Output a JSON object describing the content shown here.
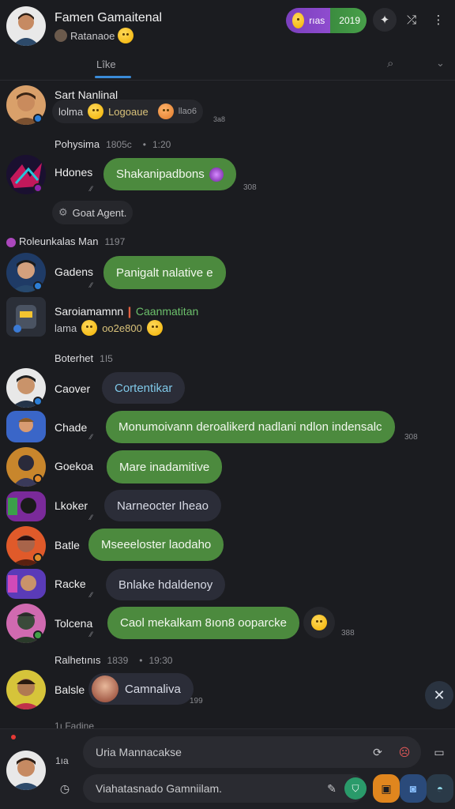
{
  "header": {
    "title": "Famen Gamaitenal",
    "subtitle": "Ratanaoe",
    "pill_left": "rıas",
    "pill_right": "2019"
  },
  "tab": {
    "label": "Lîke"
  },
  "messages": [
    {
      "name": "Sart Nanlinal",
      "text1": "lolma",
      "text2": "Logoaue",
      "meta": "llao6",
      "tick": "3a8"
    },
    {
      "name": "Pohysima",
      "time": "1805c",
      "time2": "1:20"
    },
    {
      "name": "Hdones",
      "text": "Shakanipadbons",
      "tick": "308"
    },
    {
      "name": "Goat Agent.",
      "system": true
    },
    {
      "name": "Roleunkalas Man",
      "time": "1197"
    },
    {
      "name": "Gadens",
      "text": "Panigalt nalative e"
    },
    {
      "name": "Saroiamamnn",
      "extra": "Caanmatitan",
      "sub1": "lama",
      "sub2": "oo2e800"
    },
    {
      "name": "Boterhet",
      "time": "1I5"
    },
    {
      "name": "Caover",
      "text": "Cortentikar"
    },
    {
      "name": "Chade",
      "text": "Monumoivann deroalikerd nadlani ndlon indensalc",
      "tick": "308"
    },
    {
      "name": "Goekoa",
      "text": "Mare inadamitive"
    },
    {
      "name": "Lkoker",
      "text": "Narneocter Iheao"
    },
    {
      "name": "Batle",
      "text": "Mseeeloster laodaho"
    },
    {
      "name": "Racke",
      "text": "Bnlake hdaldenoy"
    },
    {
      "name": "Tolcena",
      "text": "Caol mekalkam 8ıon8 ooparcke",
      "tick": "388"
    },
    {
      "name": "Ralhetınıs",
      "time": "1839",
      "time2": "19:30"
    },
    {
      "name": "Balsle",
      "text": "Camnaliva",
      "tick": "199"
    }
  ],
  "typing": "1ı Fadine",
  "composer": {
    "count": "1ıa",
    "input1_placeholder": "Uria Mannacakse",
    "input2_placeholder": "Viahatasnado Gamniilam."
  },
  "colors": {
    "bubble_green": "#4c8a3e",
    "bubble_dark": "#2b2d38",
    "background": "#1b1c20",
    "accent_blue": "#3a8bd8"
  }
}
